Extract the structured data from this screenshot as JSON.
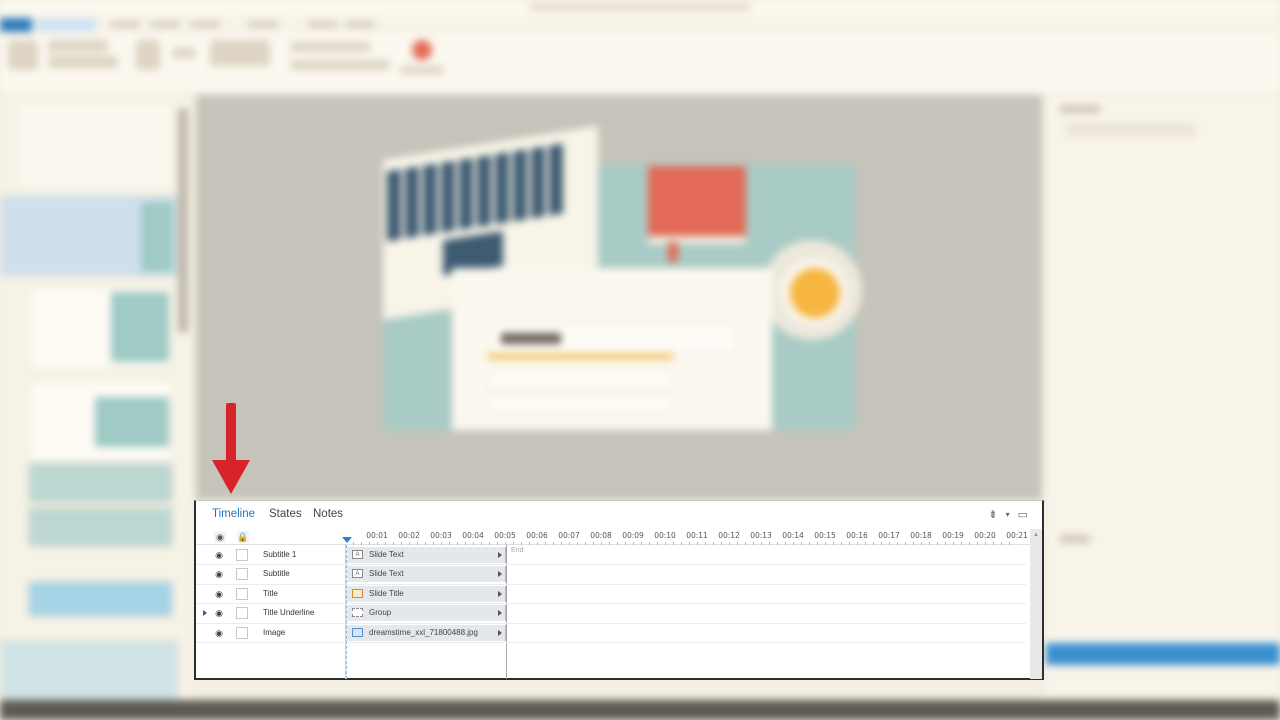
{
  "timeline_panel": {
    "tabs": [
      {
        "label": "Timeline",
        "active": true
      },
      {
        "label": "States",
        "active": false
      },
      {
        "label": "Notes",
        "active": false
      }
    ],
    "ruler_ticks": [
      "00:01",
      "00:02",
      "00:03",
      "00:04",
      "00:05",
      "00:06",
      "00:07",
      "00:08",
      "00:09",
      "00:10",
      "00:11",
      "00:12",
      "00:13",
      "00:14",
      "00:15",
      "00:16",
      "00:17",
      "00:18",
      "00:19",
      "00:20",
      "00:21"
    ],
    "end_label": "End",
    "rows": [
      {
        "name": "Subtitle 1",
        "object": "Slide Text",
        "icon": "text-box-icon",
        "expandable": false
      },
      {
        "name": "Subtitle",
        "object": "Slide Text",
        "icon": "text-box-icon",
        "expandable": false
      },
      {
        "name": "Title",
        "object": "Slide Title",
        "icon": "slide-title-icon",
        "expandable": false
      },
      {
        "name": "Title Underline",
        "object": "Group",
        "icon": "group-icon",
        "expandable": true
      },
      {
        "name": "Image",
        "object": "dreamstime_xxl_71800488.jpg",
        "icon": "image-icon",
        "expandable": false
      }
    ]
  },
  "colors": {
    "annotation_arrow": "#d9232a",
    "active_tab": "#2474bd",
    "playhead": "#2e84d3"
  }
}
